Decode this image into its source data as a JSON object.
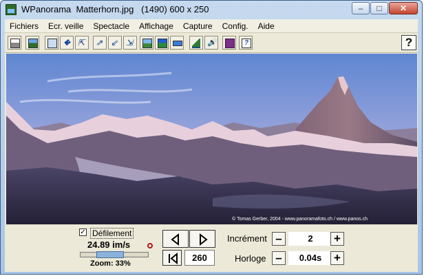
{
  "window": {
    "title": "WPanorama  Matterhorn.jpg   (1490) 600 x 250",
    "minimize": "–",
    "maximize": "□",
    "close": "✕"
  },
  "menu": [
    "Fichiers",
    "Ecr. veille",
    "Spectacle",
    "Affichage",
    "Capture",
    "Config.",
    "Aide"
  ],
  "toolbar": {
    "icons": [
      "print-icon",
      "image-icon",
      "window-icon",
      "move-icon",
      "shrink-left-icon",
      "expand-icon",
      "shrink-icon",
      "expand-right-icon",
      "landscape-icon",
      "landscape-blue-icon",
      "strip-icon",
      "mountain-icon",
      "sound-icon",
      "book-icon",
      "help-doc-icon"
    ],
    "help_label": "?"
  },
  "photo": {
    "credit": "© Tomas Gerber, 2004 - www.panoramafoto.ch / www.panos.ch"
  },
  "controls": {
    "scroll_checked": true,
    "scroll_label": "Défilement",
    "speed": "24.89 im/s",
    "slider_level": 0.33,
    "zoom": "Zoom: 33%",
    "frame": "260",
    "increment_label": "Incrément",
    "increment_value": "2",
    "clock_label": "Horloge",
    "clock_value": "0.04s",
    "minus": "–",
    "plus": "+"
  },
  "colors": {
    "sky_top": "#5f86d2",
    "sky_bottom": "#c8c3e4",
    "mountain": "#6a5a7a",
    "snow_pink": "#ecd3e0",
    "foreground": "#2e2946"
  }
}
